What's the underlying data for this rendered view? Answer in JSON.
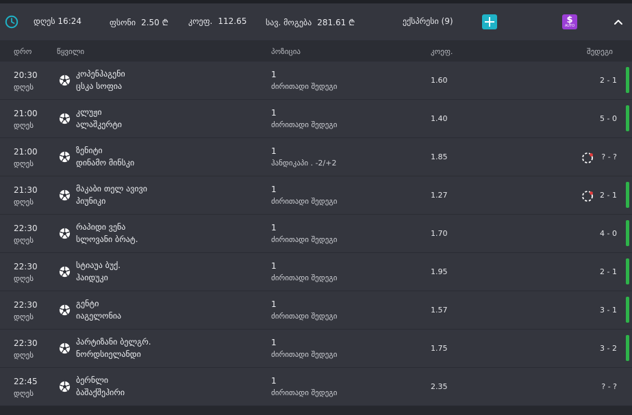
{
  "header": {
    "today_label": "დღეს 16:24",
    "stake_label": "ფსონი",
    "stake_value": "2.50 ₾",
    "odds_label": "კოეფ.",
    "odds_value": "112.65",
    "win_label": "სავ. მოგება",
    "win_value": "281.61 ₾",
    "express_label": "ექსპრესი (9)",
    "auto_label": "AUTO",
    "icons": {
      "clock": "clock-icon",
      "plus": "plus-icon",
      "auto": "auto-dollar-icon",
      "collapse": "chevron-up-icon"
    },
    "colors": {
      "clock": "#1fb3c7",
      "plus": "#1fb3c7",
      "auto": "#9b3fd6"
    }
  },
  "columns": {
    "time": "დრო",
    "event": "წყვილი",
    "position": "პოზიცია",
    "odds": "კოეფ.",
    "result": "შედეგი"
  },
  "rows": [
    {
      "time": "20:30",
      "day": "დღეს",
      "home": "კოპენჰაგენი",
      "away": "ცსკა სოფია",
      "pick": "1",
      "market": "ძირითადი შედეგი",
      "odds": "1.60",
      "score": "2 - 1",
      "pending": false,
      "win": true
    },
    {
      "time": "21:00",
      "day": "დღეს",
      "home": "კლუჟი",
      "away": "ალაშკერტი",
      "pick": "1",
      "market": "ძირითადი შედეგი",
      "odds": "1.40",
      "score": "5 - 0",
      "pending": false,
      "win": true
    },
    {
      "time": "21:00",
      "day": "დღეს",
      "home": "ზენიტი",
      "away": "დინამო მინსკი",
      "pick": "1",
      "market": "ჰანდიკაპი . -2/+2",
      "odds": "1.85",
      "score": "? - ?",
      "pending": true,
      "win": false
    },
    {
      "time": "21:30",
      "day": "დღეს",
      "home": "მაკაბი თელ ავივი",
      "away": "პიუნიკი",
      "pick": "1",
      "market": "ძირითადი შედეგი",
      "odds": "1.27",
      "score": "2 - 1",
      "pending": true,
      "win": true
    },
    {
      "time": "22:30",
      "day": "დღეს",
      "home": "რაპიდი ვენა",
      "away": "სლოვანი ბრატ.",
      "pick": "1",
      "market": "ძირითადი შედეგი",
      "odds": "1.70",
      "score": "4 - 0",
      "pending": false,
      "win": true
    },
    {
      "time": "22:30",
      "day": "დღეს",
      "home": "სტიაუა ბუქ.",
      "away": "ჰაიდუკი",
      "pick": "1",
      "market": "ძირითადი შედეგი",
      "odds": "1.95",
      "score": "2 - 1",
      "pending": false,
      "win": true
    },
    {
      "time": "22:30",
      "day": "დღეს",
      "home": "გენტი",
      "away": "იაგელონია",
      "pick": "1",
      "market": "ძირითადი შედეგი",
      "odds": "1.57",
      "score": "3 - 1",
      "pending": false,
      "win": true
    },
    {
      "time": "22:30",
      "day": "დღეს",
      "home": "პარტიზანი ბელგრ.",
      "away": "ნორდსიელანდი",
      "pick": "1",
      "market": "ძირითადი შედეგი",
      "odds": "1.75",
      "score": "3 - 2",
      "pending": false,
      "win": true
    },
    {
      "time": "22:45",
      "day": "დღეს",
      "home": "ბერნლი",
      "away": "ბაშაქშეჰირი",
      "pick": "1",
      "market": "ძირითადი შედეგი",
      "odds": "2.35",
      "score": "? - ?",
      "pending": false,
      "win": false
    }
  ],
  "row_icon": "soccer-ball-icon",
  "status_colors": {
    "win": "#2eb34a",
    "pending": "#e23b3b"
  }
}
